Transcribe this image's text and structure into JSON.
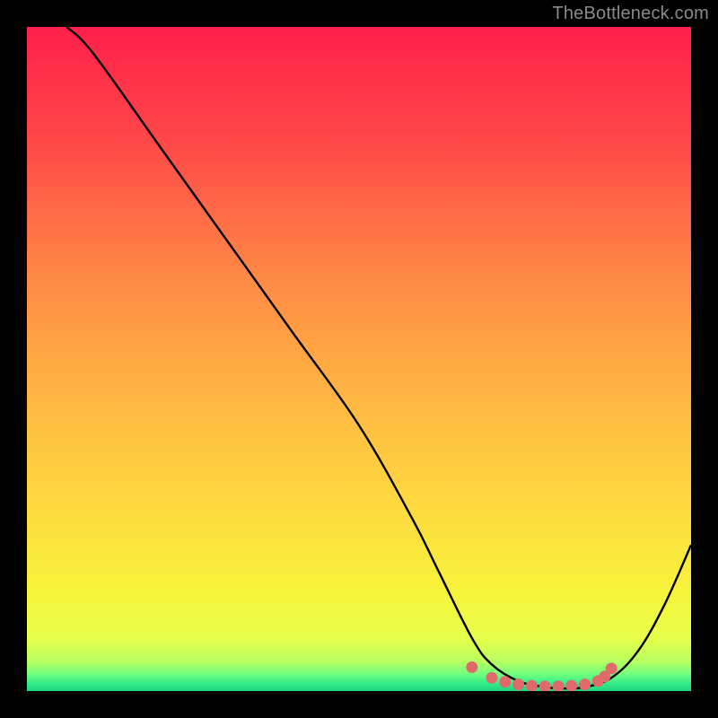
{
  "attribution": "TheBottleneck.com",
  "chart_data": {
    "type": "line",
    "title": "",
    "xlabel": "",
    "ylabel": "",
    "xlim": [
      0,
      100
    ],
    "ylim": [
      0,
      100
    ],
    "grid": false,
    "legend": false,
    "series": [
      {
        "name": "curve",
        "x": [
          6,
          10,
          20,
          30,
          40,
          50,
          58,
          62,
          67,
          70,
          74,
          78,
          81,
          84,
          88,
          92,
          96,
          100
        ],
        "y": [
          100,
          96,
          82,
          68,
          54,
          40,
          26,
          18,
          8,
          4,
          1.5,
          0.6,
          0.4,
          0.6,
          2,
          6,
          13,
          22
        ]
      },
      {
        "name": "optimal-band",
        "x": [
          67,
          70,
          72,
          74,
          76,
          78,
          80,
          82,
          84,
          86,
          87,
          88
        ],
        "y": [
          3.6,
          2.0,
          1.4,
          1.0,
          0.8,
          0.7,
          0.7,
          0.8,
          1.0,
          1.5,
          2.2,
          3.4
        ]
      }
    ],
    "gradient_stops": [
      {
        "offset": 0.0,
        "color": "#ff1f4b"
      },
      {
        "offset": 0.18,
        "color": "#ff4a48"
      },
      {
        "offset": 0.38,
        "color": "#ff8a45"
      },
      {
        "offset": 0.55,
        "color": "#ffb443"
      },
      {
        "offset": 0.72,
        "color": "#ffd93f"
      },
      {
        "offset": 0.85,
        "color": "#f7f33b"
      },
      {
        "offset": 0.92,
        "color": "#e7ff4a"
      },
      {
        "offset": 0.955,
        "color": "#b8ff60"
      },
      {
        "offset": 0.975,
        "color": "#6fff7e"
      },
      {
        "offset": 0.99,
        "color": "#2fe98a"
      },
      {
        "offset": 1.0,
        "color": "#1fd37a"
      }
    ],
    "colors": {
      "curve_stroke": "#000000",
      "dot_fill": "#e06a6a",
      "background": "#000000"
    }
  }
}
